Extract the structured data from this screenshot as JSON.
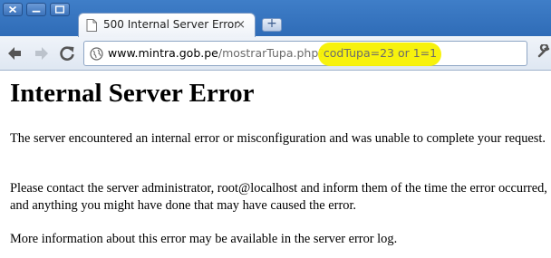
{
  "browser": {
    "tab": {
      "title": "500 Internal Server Error",
      "close_glyph": "×"
    },
    "new_tab_glyph": "+",
    "address_bar": {
      "host": "www.mintra.gob.pe",
      "path": "/mostrarTupa.php?",
      "query": "codTupa=23 or 1=1",
      "highlight_color": "#f7f100"
    },
    "icons": [
      "close-window-icon",
      "minimize-icon",
      "maximize-icon",
      "page-icon",
      "back-arrow-icon",
      "forward-arrow-icon",
      "reload-icon",
      "globe-icon",
      "wrench-icon"
    ]
  },
  "page": {
    "heading": "Internal Server Error",
    "paragraphs": [
      "The server encountered an internal error or misconfiguration and was unable to complete your request.",
      "Please contact the server administrator, root@localhost and inform them of the time the error occurred, and anything you might have done that may have caused the error.",
      "More information about this error may be available in the server error log."
    ]
  }
}
